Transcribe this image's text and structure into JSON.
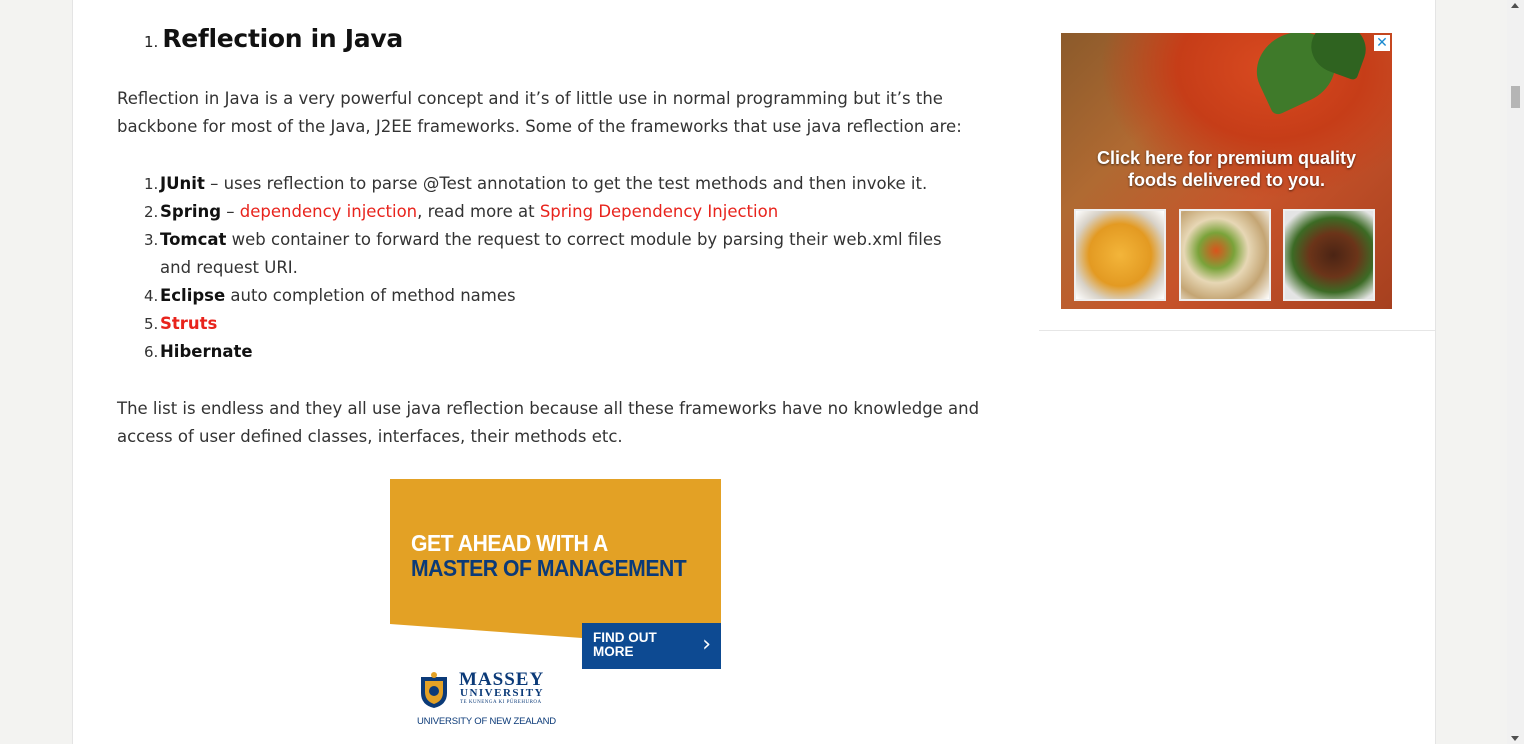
{
  "article": {
    "heading_number": "1.",
    "heading": "Reflection in Java",
    "intro": "Reflection in Java is a very powerful concept and it’s of little use in normal programming but it’s the backbone for most of the Java, J2EE frameworks. Some of the frameworks that use java reflection are:",
    "frameworks": [
      {
        "num": "1.",
        "name": "JUnit",
        "text": " – uses reflection to parse @Test annotation to get the test methods and then invoke it."
      },
      {
        "num": "2.",
        "name": "Spring",
        "sep": " – ",
        "link1": "dependency injection",
        "mid": ", read more at ",
        "link2": "Spring Dependency Injection"
      },
      {
        "num": "3.",
        "name": "Tomcat",
        "text": " web container to forward the request to correct module by parsing their web.xml files and request URI."
      },
      {
        "num": "4.",
        "name": "Eclipse",
        "text": " auto completion of method names"
      },
      {
        "num": "5.",
        "name": "Struts"
      },
      {
        "num": "6.",
        "name": "Hibernate"
      }
    ],
    "outro": "The list is endless and they all use java reflection because all these frameworks have no knowledge and access of user defined classes, interfaces, their methods etc."
  },
  "ad_massey": {
    "headline_1": "GET AHEAD WITH A",
    "headline_2": "MASTER OF MANAGEMENT",
    "cta_1": "FIND OUT",
    "cta_2": "MORE",
    "logo_name": "MASSEY",
    "logo_sub": "UNIVERSITY",
    "logo_maori": "TE KUNENGA KI PŪREHUROA",
    "logo_tag": "UNIVERSITY OF NEW ZEALAND",
    "colors": {
      "orange": "#e3a125",
      "navy": "#0b3a78",
      "button": "#0d4a92"
    }
  },
  "ad_food": {
    "line_1": "Click here for premium quality",
    "line_2": "foods delivered to you.",
    "close_icon": "close-icon"
  },
  "colors": {
    "link": "#e8231c",
    "text": "#333333"
  }
}
